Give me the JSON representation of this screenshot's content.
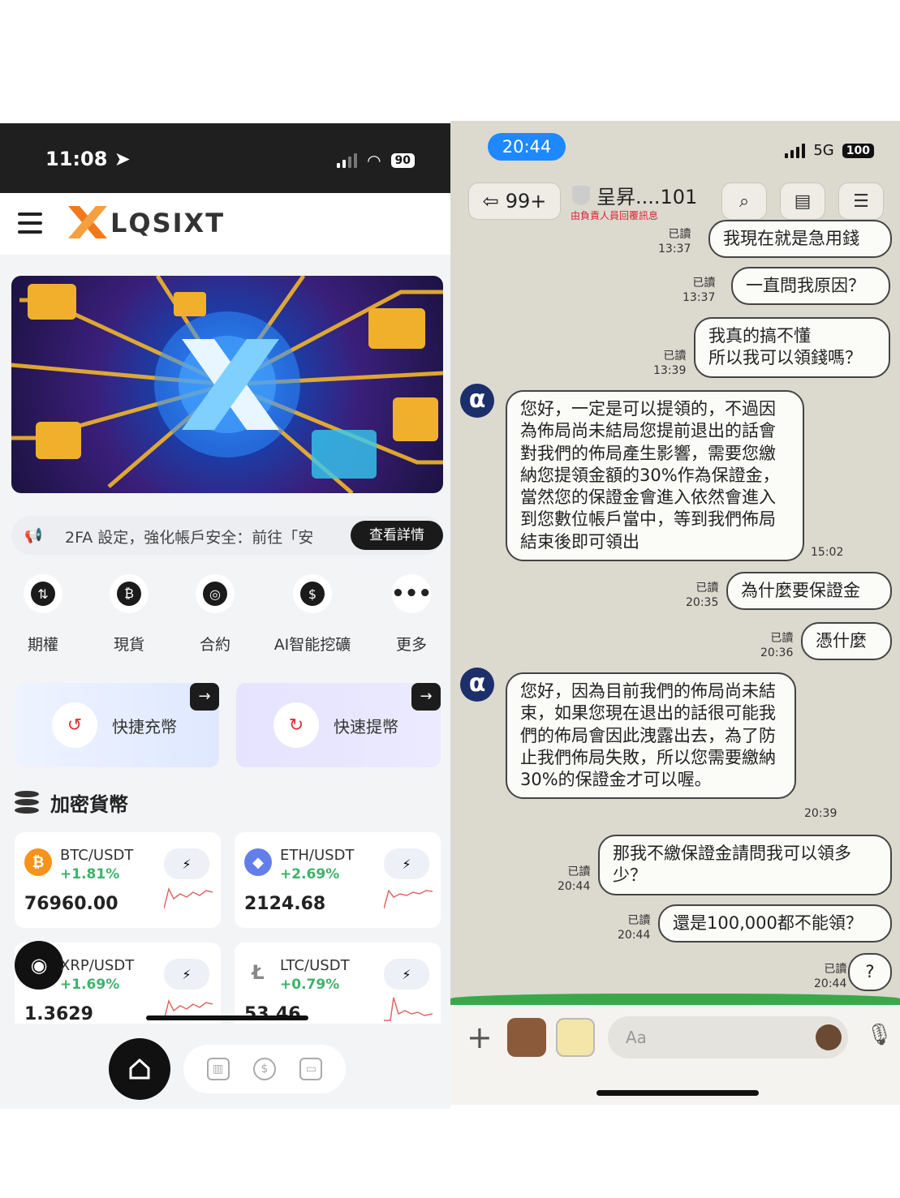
{
  "left_phone": {
    "status": {
      "time": "11:08",
      "battery": "90"
    },
    "brand": "LQSIXT",
    "notice": {
      "text": "2FA 設定，強化帳戶安全：前往「安",
      "button": "查看詳情"
    },
    "quick_actions": [
      {
        "label": "期權",
        "icon": "options-icon"
      },
      {
        "label": "現貨",
        "icon": "spot-icon"
      },
      {
        "label": "合約",
        "icon": "contract-icon"
      },
      {
        "label": "AI智能挖礦",
        "icon": "ai-mining-icon"
      },
      {
        "label": "更多",
        "icon": "more-icon"
      }
    ],
    "deposit_label": "快捷充幣",
    "withdraw_label": "快速提幣",
    "section_title": "加密貨幣",
    "coins": [
      {
        "pair": "BTC/USDT",
        "change": "+1.81%",
        "price": "76960.00",
        "color": "#f7931a",
        "symbol": "₿"
      },
      {
        "pair": "ETH/USDT",
        "change": "+2.69%",
        "price": "2124.68",
        "color": "#627eea",
        "symbol": "◆"
      },
      {
        "pair": "XRP/USDT",
        "change": "+1.69%",
        "price": "1.3629",
        "color": "#111111",
        "symbol": "✕"
      },
      {
        "pair": "LTC/USDT",
        "change": "+0.79%",
        "price": "53.46",
        "color": "#888888",
        "symbol": "Ł"
      }
    ]
  },
  "right_phone": {
    "status": {
      "time": "20:44",
      "network": "5G",
      "battery": "100"
    },
    "back_count": "99+",
    "chat_title": "呈昇....101",
    "chat_subtitle": "由負責人員回覆訊息",
    "messages": [
      {
        "side": "right",
        "text": "我現在就是急用錢",
        "read": "已讀",
        "time": "13:37"
      },
      {
        "side": "right",
        "text": "一直問我原因？",
        "read": "已讀",
        "time": "13:37"
      },
      {
        "side": "right",
        "text": "我真的搞不懂\n所以我可以領錢嗎？",
        "read": "已讀",
        "time": "13:39"
      },
      {
        "side": "left",
        "text": "您好，一定是可以提領的，不過因為佈局尚未結局您提前退出的話會對我們的佈局產生影響，需要您繳納您提領金額的30%作為保證金，當然您的保證金會進入依然會進入到您數位帳戶當中，等到我們佈局結束後即可領出",
        "time": "15:02"
      },
      {
        "side": "right",
        "text": "為什麼要保證金",
        "read": "已讀",
        "time": "20:35"
      },
      {
        "side": "right",
        "text": "憑什麼",
        "read": "已讀",
        "time": "20:36"
      },
      {
        "side": "left",
        "text": "您好，因為目前我們的佈局尚未結束，如果您現在退出的話很可能我們的佈局會因此洩露出去，為了防止我們佈局失敗，所以您需要繳納30%的保證金才可以喔。",
        "time": "20:39"
      },
      {
        "side": "right",
        "text": "那我不繳保證金請問我可以領多少？",
        "read": "已讀",
        "time": "20:44"
      },
      {
        "side": "right",
        "text": "還是100,000都不能領？",
        "read": "已讀",
        "time": "20:44"
      },
      {
        "side": "right",
        "text": "?",
        "read": "已讀",
        "time": "20:44"
      }
    ],
    "input_placeholder": "Aa"
  }
}
